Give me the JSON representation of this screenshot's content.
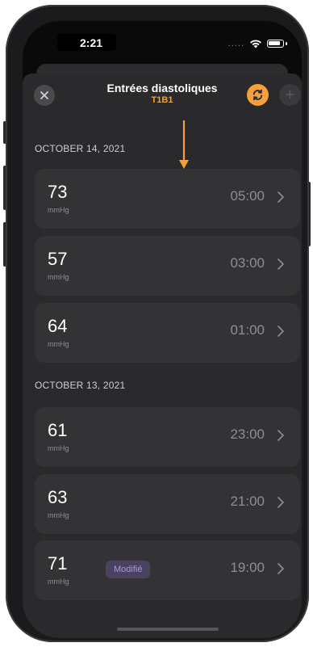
{
  "status_bar": {
    "time": "2:21",
    "dots": "....."
  },
  "header": {
    "title": "Entrées diastoliques",
    "subtitle": "T1B1",
    "close_icon": "close-icon",
    "sync_icon": "sync-icon",
    "add_icon": "plus-icon",
    "add_symbol": "+"
  },
  "sections": [
    {
      "title": "OCTOBER 14, 2021",
      "rows": [
        {
          "value": "73",
          "unit": "mmHg",
          "time": "05:00"
        },
        {
          "value": "57",
          "unit": "mmHg",
          "time": "03:00"
        },
        {
          "value": "64",
          "unit": "mmHg",
          "time": "01:00"
        }
      ]
    },
    {
      "title": "OCTOBER 13, 2021",
      "rows": [
        {
          "value": "61",
          "unit": "mmHg",
          "time": "23:00"
        },
        {
          "value": "63",
          "unit": "mmHg",
          "time": "21:00"
        },
        {
          "value": "71",
          "unit": "mmHg",
          "time": "19:00",
          "badge": "Modifié"
        }
      ]
    }
  ],
  "colors": {
    "accent": "#f5a03a",
    "badge_bg": "#4a4260",
    "badge_text": "#a89ad6",
    "row_bg": "#333335"
  }
}
